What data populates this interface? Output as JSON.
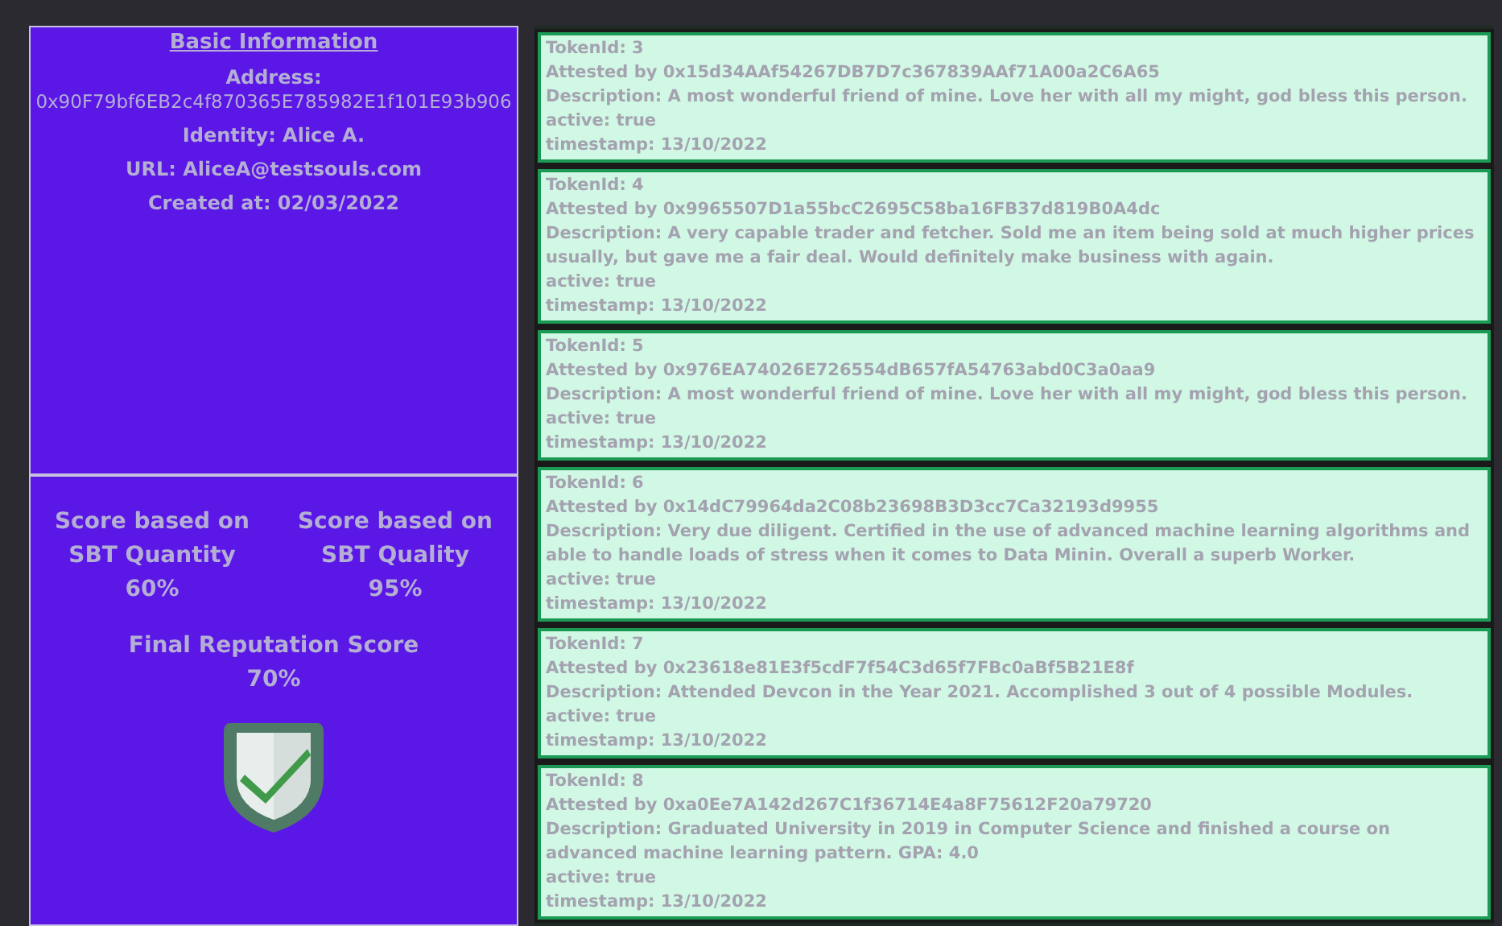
{
  "basic_info": {
    "title": "Basic Information",
    "address_label": "Address:",
    "address": "0x90F79bf6EB2c4f870365E785982E1f101E93b906",
    "identity": "Identity: Alice A.",
    "url": "URL: AliceA@testsouls.com",
    "created": "Created at: 02/03/2022"
  },
  "scores": {
    "quantity": {
      "label": "Score based on SBT Quantity",
      "value": "60%"
    },
    "quality": {
      "label": "Score based on SBT Quality",
      "value": "95%"
    },
    "final": {
      "label": "Final Reputation Score",
      "value": "70%"
    }
  },
  "tokens": [
    {
      "token_id": "TokenId: 3",
      "attested_by": "Attested by 0x15d34AAf54267DB7D7c367839AAf71A00a2C6A65",
      "description": "Description: A most wonderful friend of mine. Love her with all my might, god bless this person.",
      "active": "active: true",
      "timestamp": "timestamp: 13/10/2022"
    },
    {
      "token_id": "TokenId: 4",
      "attested_by": "Attested by 0x9965507D1a55bcC2695C58ba16FB37d819B0A4dc",
      "description": "Description: A very capable trader and fetcher. Sold me an item being sold at much higher prices usually, but gave me a fair deal. Would definitely make business with again.",
      "active": "active: true",
      "timestamp": "timestamp: 13/10/2022"
    },
    {
      "token_id": "TokenId: 5",
      "attested_by": "Attested by 0x976EA74026E726554dB657fA54763abd0C3a0aa9",
      "description": "Description: A most wonderful friend of mine. Love her with all my might, god bless this person.",
      "active": "active: true",
      "timestamp": "timestamp: 13/10/2022"
    },
    {
      "token_id": "TokenId: 6",
      "attested_by": "Attested by 0x14dC79964da2C08b23698B3D3cc7Ca32193d9955",
      "description": "Description: Very due diligent. Certified in the use of advanced machine learning algorithms and able to handle loads of stress when it comes to Data Minin. Overall a superb Worker.",
      "active": "active: true",
      "timestamp": "timestamp: 13/10/2022"
    },
    {
      "token_id": "TokenId: 7",
      "attested_by": "Attested by 0x23618e81E3f5cdF7f54C3d65f7FBc0aBf5B21E8f",
      "description": "Description: Attended Devcon in the Year 2021. Accomplished 3 out of 4 possible Modules.",
      "active": "active: true",
      "timestamp": "timestamp: 13/10/2022"
    },
    {
      "token_id": "TokenId: 8",
      "attested_by": "Attested by 0xa0Ee7A142d267C1f36714E4a8F75612F20a79720",
      "description": "Description: Graduated University in 2019 in Computer Science and finished a course on advanced machine learning pattern. GPA: 4.0",
      "active": "active: true",
      "timestamp": "timestamp: 13/10/2022"
    }
  ]
}
